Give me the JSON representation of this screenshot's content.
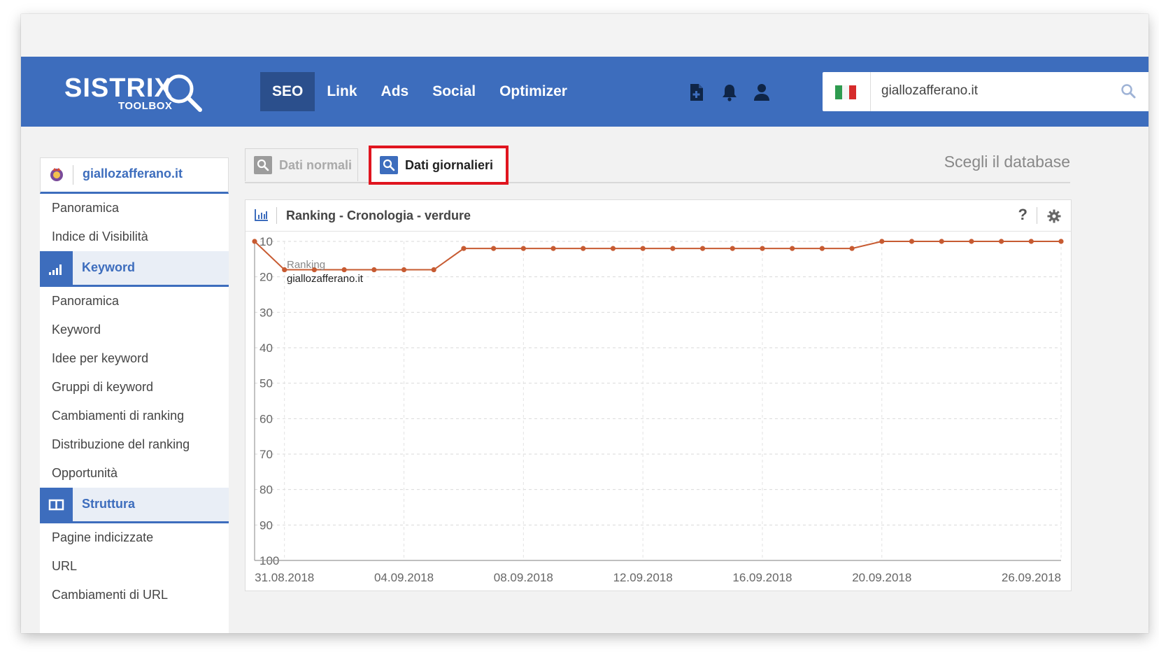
{
  "header": {
    "logo": "SISTRIX",
    "logo_sub": "TOOLBOX",
    "nav": [
      "SEO",
      "Link",
      "Ads",
      "Social",
      "Optimizer"
    ],
    "active_nav": "SEO",
    "icons": [
      "new-document-icon",
      "bell-icon",
      "user-icon"
    ],
    "search": {
      "value": "giallozafferano.it",
      "flag": "italy-flag-icon",
      "icon": "search-icon"
    }
  },
  "sidebar": {
    "domain": "giallozafferano.it",
    "top_items": [
      "Panoramica",
      "Indice di Visibilità"
    ],
    "keyword_section": "Keyword",
    "keyword_items": [
      "Panoramica",
      "Keyword",
      "Idee per keyword",
      "Gruppi di keyword",
      "Cambiamenti di ranking",
      "Distribuzione del ranking",
      "Opportunità"
    ],
    "struttura_section": "Struttura",
    "struttura_items": [
      "Pagine indicizzate",
      "URL",
      "Cambiamenti di URL"
    ]
  },
  "tabs": {
    "normal": "Dati normali",
    "daily": "Dati giornalieri",
    "database": "Scegli il database"
  },
  "panel": {
    "title": "Ranking - Cronologia - verdure",
    "help": "?"
  },
  "colors": {
    "brand": "#3d6dbd",
    "brand_dark": "#2b4f8c",
    "highlight": "#e0151f",
    "series": "#c75b32"
  },
  "chart_data": {
    "type": "line",
    "title": "Ranking - Cronologia - verdure",
    "y_ticks": [
      "10",
      "20",
      "30",
      "40",
      "50",
      "60",
      "70",
      "80",
      "90",
      "100"
    ],
    "ylim": [
      100,
      10
    ],
    "y_inverted": true,
    "x_ticks": [
      "31.08.2018",
      "04.09.2018",
      "08.09.2018",
      "12.09.2018",
      "16.09.2018",
      "20.09.2018",
      "26.09.2018"
    ],
    "x_tick_days": [
      1,
      5,
      9,
      13,
      17,
      21,
      27
    ],
    "tooltip": {
      "label": "Ranking",
      "value": "giallozafferano.it"
    },
    "series": [
      {
        "name": "giallozafferano.it",
        "x_days": [
          0,
          1,
          2,
          3,
          4,
          5,
          6,
          7,
          8,
          9,
          10,
          11,
          12,
          13,
          14,
          15,
          16,
          17,
          18,
          19,
          20,
          21,
          22,
          23,
          24,
          25,
          26,
          27
        ],
        "values": [
          10,
          18,
          18,
          18,
          18,
          18,
          18,
          12,
          12,
          12,
          12,
          12,
          12,
          12,
          12,
          12,
          12,
          12,
          12,
          12,
          12,
          10,
          10,
          10,
          10,
          10,
          10,
          10
        ]
      }
    ],
    "grid": true
  }
}
